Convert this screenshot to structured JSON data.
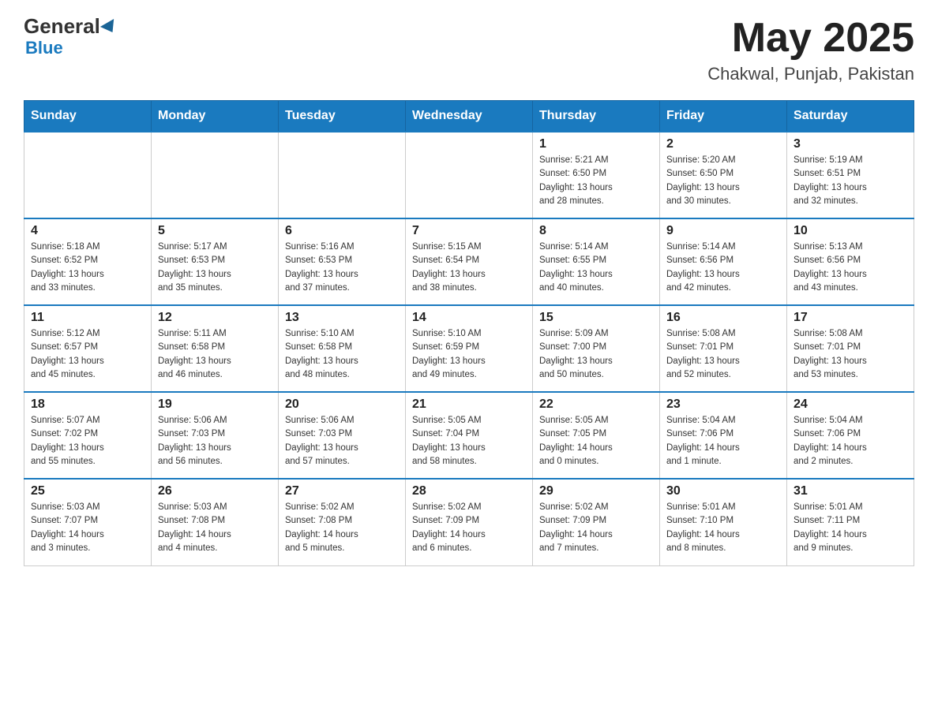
{
  "header": {
    "logo": {
      "general": "General",
      "blue": "Blue"
    },
    "title": "May 2025",
    "location": "Chakwal, Punjab, Pakistan"
  },
  "days_of_week": [
    "Sunday",
    "Monday",
    "Tuesday",
    "Wednesday",
    "Thursday",
    "Friday",
    "Saturday"
  ],
  "weeks": [
    [
      {
        "day": "",
        "info": ""
      },
      {
        "day": "",
        "info": ""
      },
      {
        "day": "",
        "info": ""
      },
      {
        "day": "",
        "info": ""
      },
      {
        "day": "1",
        "info": "Sunrise: 5:21 AM\nSunset: 6:50 PM\nDaylight: 13 hours\nand 28 minutes."
      },
      {
        "day": "2",
        "info": "Sunrise: 5:20 AM\nSunset: 6:50 PM\nDaylight: 13 hours\nand 30 minutes."
      },
      {
        "day": "3",
        "info": "Sunrise: 5:19 AM\nSunset: 6:51 PM\nDaylight: 13 hours\nand 32 minutes."
      }
    ],
    [
      {
        "day": "4",
        "info": "Sunrise: 5:18 AM\nSunset: 6:52 PM\nDaylight: 13 hours\nand 33 minutes."
      },
      {
        "day": "5",
        "info": "Sunrise: 5:17 AM\nSunset: 6:53 PM\nDaylight: 13 hours\nand 35 minutes."
      },
      {
        "day": "6",
        "info": "Sunrise: 5:16 AM\nSunset: 6:53 PM\nDaylight: 13 hours\nand 37 minutes."
      },
      {
        "day": "7",
        "info": "Sunrise: 5:15 AM\nSunset: 6:54 PM\nDaylight: 13 hours\nand 38 minutes."
      },
      {
        "day": "8",
        "info": "Sunrise: 5:14 AM\nSunset: 6:55 PM\nDaylight: 13 hours\nand 40 minutes."
      },
      {
        "day": "9",
        "info": "Sunrise: 5:14 AM\nSunset: 6:56 PM\nDaylight: 13 hours\nand 42 minutes."
      },
      {
        "day": "10",
        "info": "Sunrise: 5:13 AM\nSunset: 6:56 PM\nDaylight: 13 hours\nand 43 minutes."
      }
    ],
    [
      {
        "day": "11",
        "info": "Sunrise: 5:12 AM\nSunset: 6:57 PM\nDaylight: 13 hours\nand 45 minutes."
      },
      {
        "day": "12",
        "info": "Sunrise: 5:11 AM\nSunset: 6:58 PM\nDaylight: 13 hours\nand 46 minutes."
      },
      {
        "day": "13",
        "info": "Sunrise: 5:10 AM\nSunset: 6:58 PM\nDaylight: 13 hours\nand 48 minutes."
      },
      {
        "day": "14",
        "info": "Sunrise: 5:10 AM\nSunset: 6:59 PM\nDaylight: 13 hours\nand 49 minutes."
      },
      {
        "day": "15",
        "info": "Sunrise: 5:09 AM\nSunset: 7:00 PM\nDaylight: 13 hours\nand 50 minutes."
      },
      {
        "day": "16",
        "info": "Sunrise: 5:08 AM\nSunset: 7:01 PM\nDaylight: 13 hours\nand 52 minutes."
      },
      {
        "day": "17",
        "info": "Sunrise: 5:08 AM\nSunset: 7:01 PM\nDaylight: 13 hours\nand 53 minutes."
      }
    ],
    [
      {
        "day": "18",
        "info": "Sunrise: 5:07 AM\nSunset: 7:02 PM\nDaylight: 13 hours\nand 55 minutes."
      },
      {
        "day": "19",
        "info": "Sunrise: 5:06 AM\nSunset: 7:03 PM\nDaylight: 13 hours\nand 56 minutes."
      },
      {
        "day": "20",
        "info": "Sunrise: 5:06 AM\nSunset: 7:03 PM\nDaylight: 13 hours\nand 57 minutes."
      },
      {
        "day": "21",
        "info": "Sunrise: 5:05 AM\nSunset: 7:04 PM\nDaylight: 13 hours\nand 58 minutes."
      },
      {
        "day": "22",
        "info": "Sunrise: 5:05 AM\nSunset: 7:05 PM\nDaylight: 14 hours\nand 0 minutes."
      },
      {
        "day": "23",
        "info": "Sunrise: 5:04 AM\nSunset: 7:06 PM\nDaylight: 14 hours\nand 1 minute."
      },
      {
        "day": "24",
        "info": "Sunrise: 5:04 AM\nSunset: 7:06 PM\nDaylight: 14 hours\nand 2 minutes."
      }
    ],
    [
      {
        "day": "25",
        "info": "Sunrise: 5:03 AM\nSunset: 7:07 PM\nDaylight: 14 hours\nand 3 minutes."
      },
      {
        "day": "26",
        "info": "Sunrise: 5:03 AM\nSunset: 7:08 PM\nDaylight: 14 hours\nand 4 minutes."
      },
      {
        "day": "27",
        "info": "Sunrise: 5:02 AM\nSunset: 7:08 PM\nDaylight: 14 hours\nand 5 minutes."
      },
      {
        "day": "28",
        "info": "Sunrise: 5:02 AM\nSunset: 7:09 PM\nDaylight: 14 hours\nand 6 minutes."
      },
      {
        "day": "29",
        "info": "Sunrise: 5:02 AM\nSunset: 7:09 PM\nDaylight: 14 hours\nand 7 minutes."
      },
      {
        "day": "30",
        "info": "Sunrise: 5:01 AM\nSunset: 7:10 PM\nDaylight: 14 hours\nand 8 minutes."
      },
      {
        "day": "31",
        "info": "Sunrise: 5:01 AM\nSunset: 7:11 PM\nDaylight: 14 hours\nand 9 minutes."
      }
    ]
  ]
}
